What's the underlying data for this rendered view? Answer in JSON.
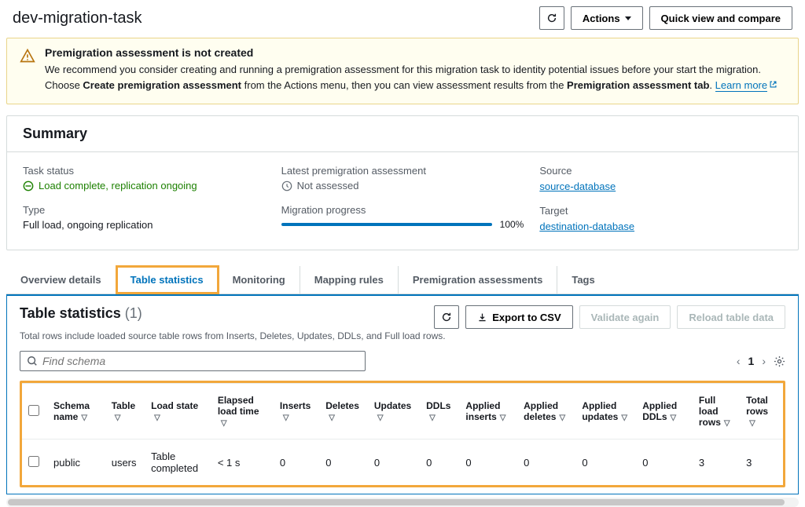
{
  "page": {
    "title": "dev-migration-task"
  },
  "buttons": {
    "actions": "Actions",
    "quickview": "Quick view and compare",
    "export": "Export to CSV",
    "validate": "Validate again",
    "reload": "Reload table data"
  },
  "alert": {
    "title": "Premigration assessment is not created",
    "body_pre": "We recommend you consider creating and running a premigration assessment for this migration task to identity potential issues before your start the migration. Choose ",
    "bold1": "Create premigration assessment",
    "body_mid": " from the Actions menu, then you can view assessment results from the ",
    "bold2": "Premigration assessment tab",
    "body_post": ". ",
    "learn_more": "Learn more"
  },
  "summary": {
    "heading": "Summary",
    "task_status_label": "Task status",
    "task_status_value": "Load complete, replication ongoing",
    "type_label": "Type",
    "type_value": "Full load, ongoing replication",
    "assessment_label": "Latest premigration assessment",
    "assessment_value": "Not assessed",
    "progress_label": "Migration progress",
    "progress_value": "100%",
    "source_label": "Source",
    "source_value": "source-database",
    "target_label": "Target",
    "target_value": "destination-database"
  },
  "tabs": [
    "Overview details",
    "Table statistics",
    "Monitoring",
    "Mapping rules",
    "Premigration assessments",
    "Tags"
  ],
  "stats": {
    "title": "Table statistics",
    "count": "(1)",
    "sub": "Total rows include loaded source table rows from Inserts, Deletes, Updates, DDLs, and Full load rows.",
    "search_placeholder": "Find schema",
    "page": "1"
  },
  "columns": [
    "Schema name",
    "Table",
    "Load state",
    "Elapsed load time",
    "Inserts",
    "Deletes",
    "Updates",
    "DDLs",
    "Applied inserts",
    "Applied deletes",
    "Applied updates",
    "Applied DDLs",
    "Full load rows",
    "Total rows"
  ],
  "rows": [
    {
      "schema": "public",
      "table": "users",
      "loadstate": "Table completed",
      "elapsed": "< 1 s",
      "inserts": "0",
      "deletes": "0",
      "updates": "0",
      "ddls": "0",
      "a_inserts": "0",
      "a_deletes": "0",
      "a_updates": "0",
      "a_ddls": "0",
      "full_load": "3",
      "total": "3"
    }
  ]
}
